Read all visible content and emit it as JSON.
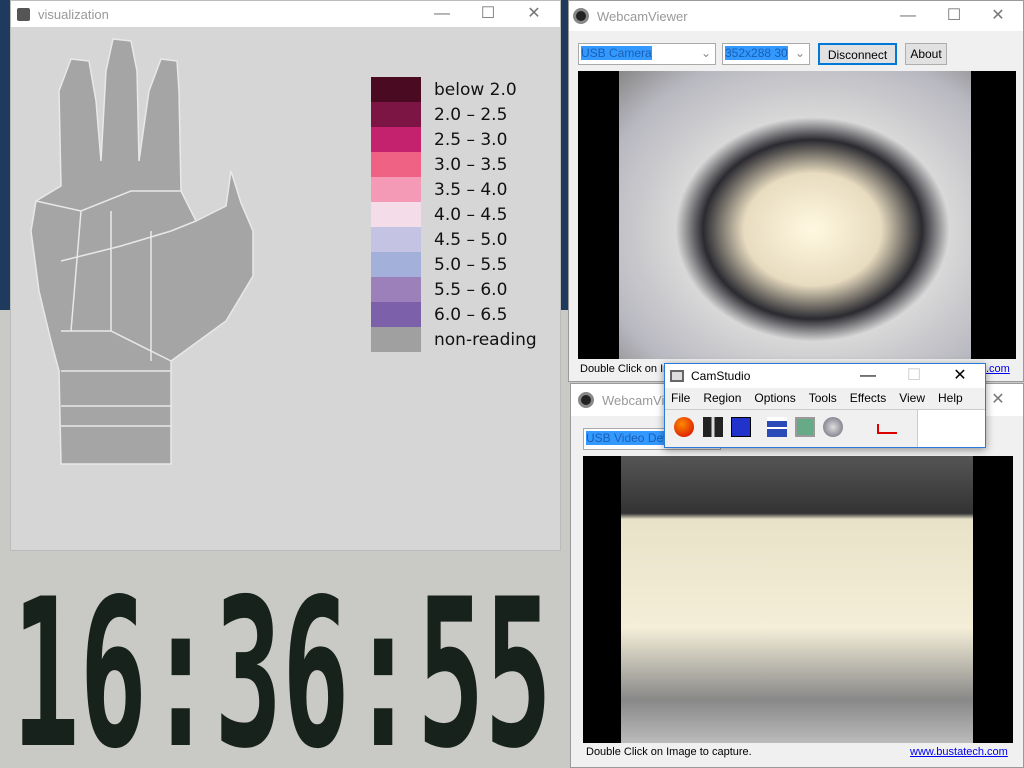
{
  "visualization": {
    "title": "visualization",
    "legend": [
      {
        "label": "below 2.0",
        "color": "#4a0b22"
      },
      {
        "label": "2.0 – 2.5",
        "color": "#7c1444"
      },
      {
        "label": "2.5 – 3.0",
        "color": "#c4226e"
      },
      {
        "label": "3.0 – 3.5",
        "color": "#f06284"
      },
      {
        "label": "3.5 – 4.0",
        "color": "#f49ab6"
      },
      {
        "label": "4.0 – 4.5",
        "color": "#f4dde9"
      },
      {
        "label": "4.5 – 5.0",
        "color": "#c5c3e3"
      },
      {
        "label": "5.0 – 5.5",
        "color": "#a3b0da"
      },
      {
        "label": "5.5 – 6.0",
        "color": "#9c80ba"
      },
      {
        "label": "6.0 – 6.5",
        "color": "#7d60aa"
      },
      {
        "label": "non-reading",
        "color": "#a0a0a0"
      }
    ],
    "hand_color": "#a5a5a5"
  },
  "clock": {
    "time": "16:36:55",
    "color": "#18221c"
  },
  "webcam_top": {
    "title": "WebcamViewer",
    "device": "USB Camera",
    "resolution": "352x288 30",
    "disconnect": "Disconnect",
    "about": "About",
    "status": "Double Click on Image to capture.",
    "link": "www.bustatech.com"
  },
  "webcam_bottom": {
    "title": "WebcamViewer",
    "device": "USB Video Device",
    "status": "Double Click on Image to capture.",
    "link": "www.bustatech.com"
  },
  "camstudio": {
    "title": "CamStudio",
    "menu": [
      "File",
      "Region",
      "Options",
      "Tools",
      "Effects",
      "View",
      "Help"
    ],
    "tools": [
      "record-icon",
      "pause-icon",
      "stop-icon",
      "annotation-icon",
      "video-icon",
      "swf-icon",
      "autopan-icon"
    ]
  }
}
